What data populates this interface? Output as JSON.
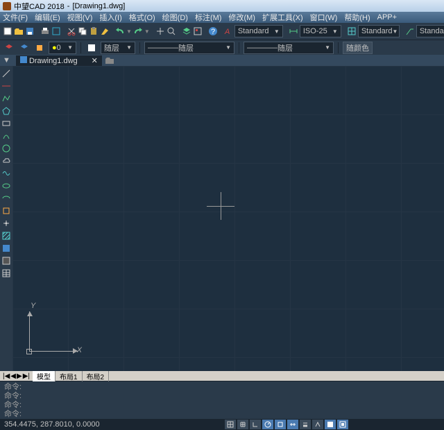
{
  "title": {
    "app": "中望CAD 2018",
    "doc": "[Drawing1.dwg]"
  },
  "menu": [
    "文件(F)",
    "编辑(E)",
    "视图(V)",
    "插入(I)",
    "格式(O)",
    "绘图(D)",
    "标注(M)",
    "修改(M)",
    "扩展工具(X)",
    "窗口(W)",
    "帮助(H)",
    "APP+"
  ],
  "toolbar2": {
    "layer": "随层",
    "style1": "Standard",
    "dimstyle": "ISO-25",
    "style2": "Standard",
    "style3": "Standard",
    "color1": "随层",
    "color2": "随层",
    "color3": "随颜色"
  },
  "tab": {
    "name": "Drawing1.dwg"
  },
  "layouts": [
    "模型",
    "布局1",
    "布局2"
  ],
  "cmd": {
    "l1": "命令:",
    "l2": "命令:",
    "l3": "命令:",
    "l4": "命令:"
  },
  "status": {
    "coords": "354.4475, 287.8010, 0.0000"
  },
  "ucs": {
    "x": "X",
    "y": "Y"
  }
}
